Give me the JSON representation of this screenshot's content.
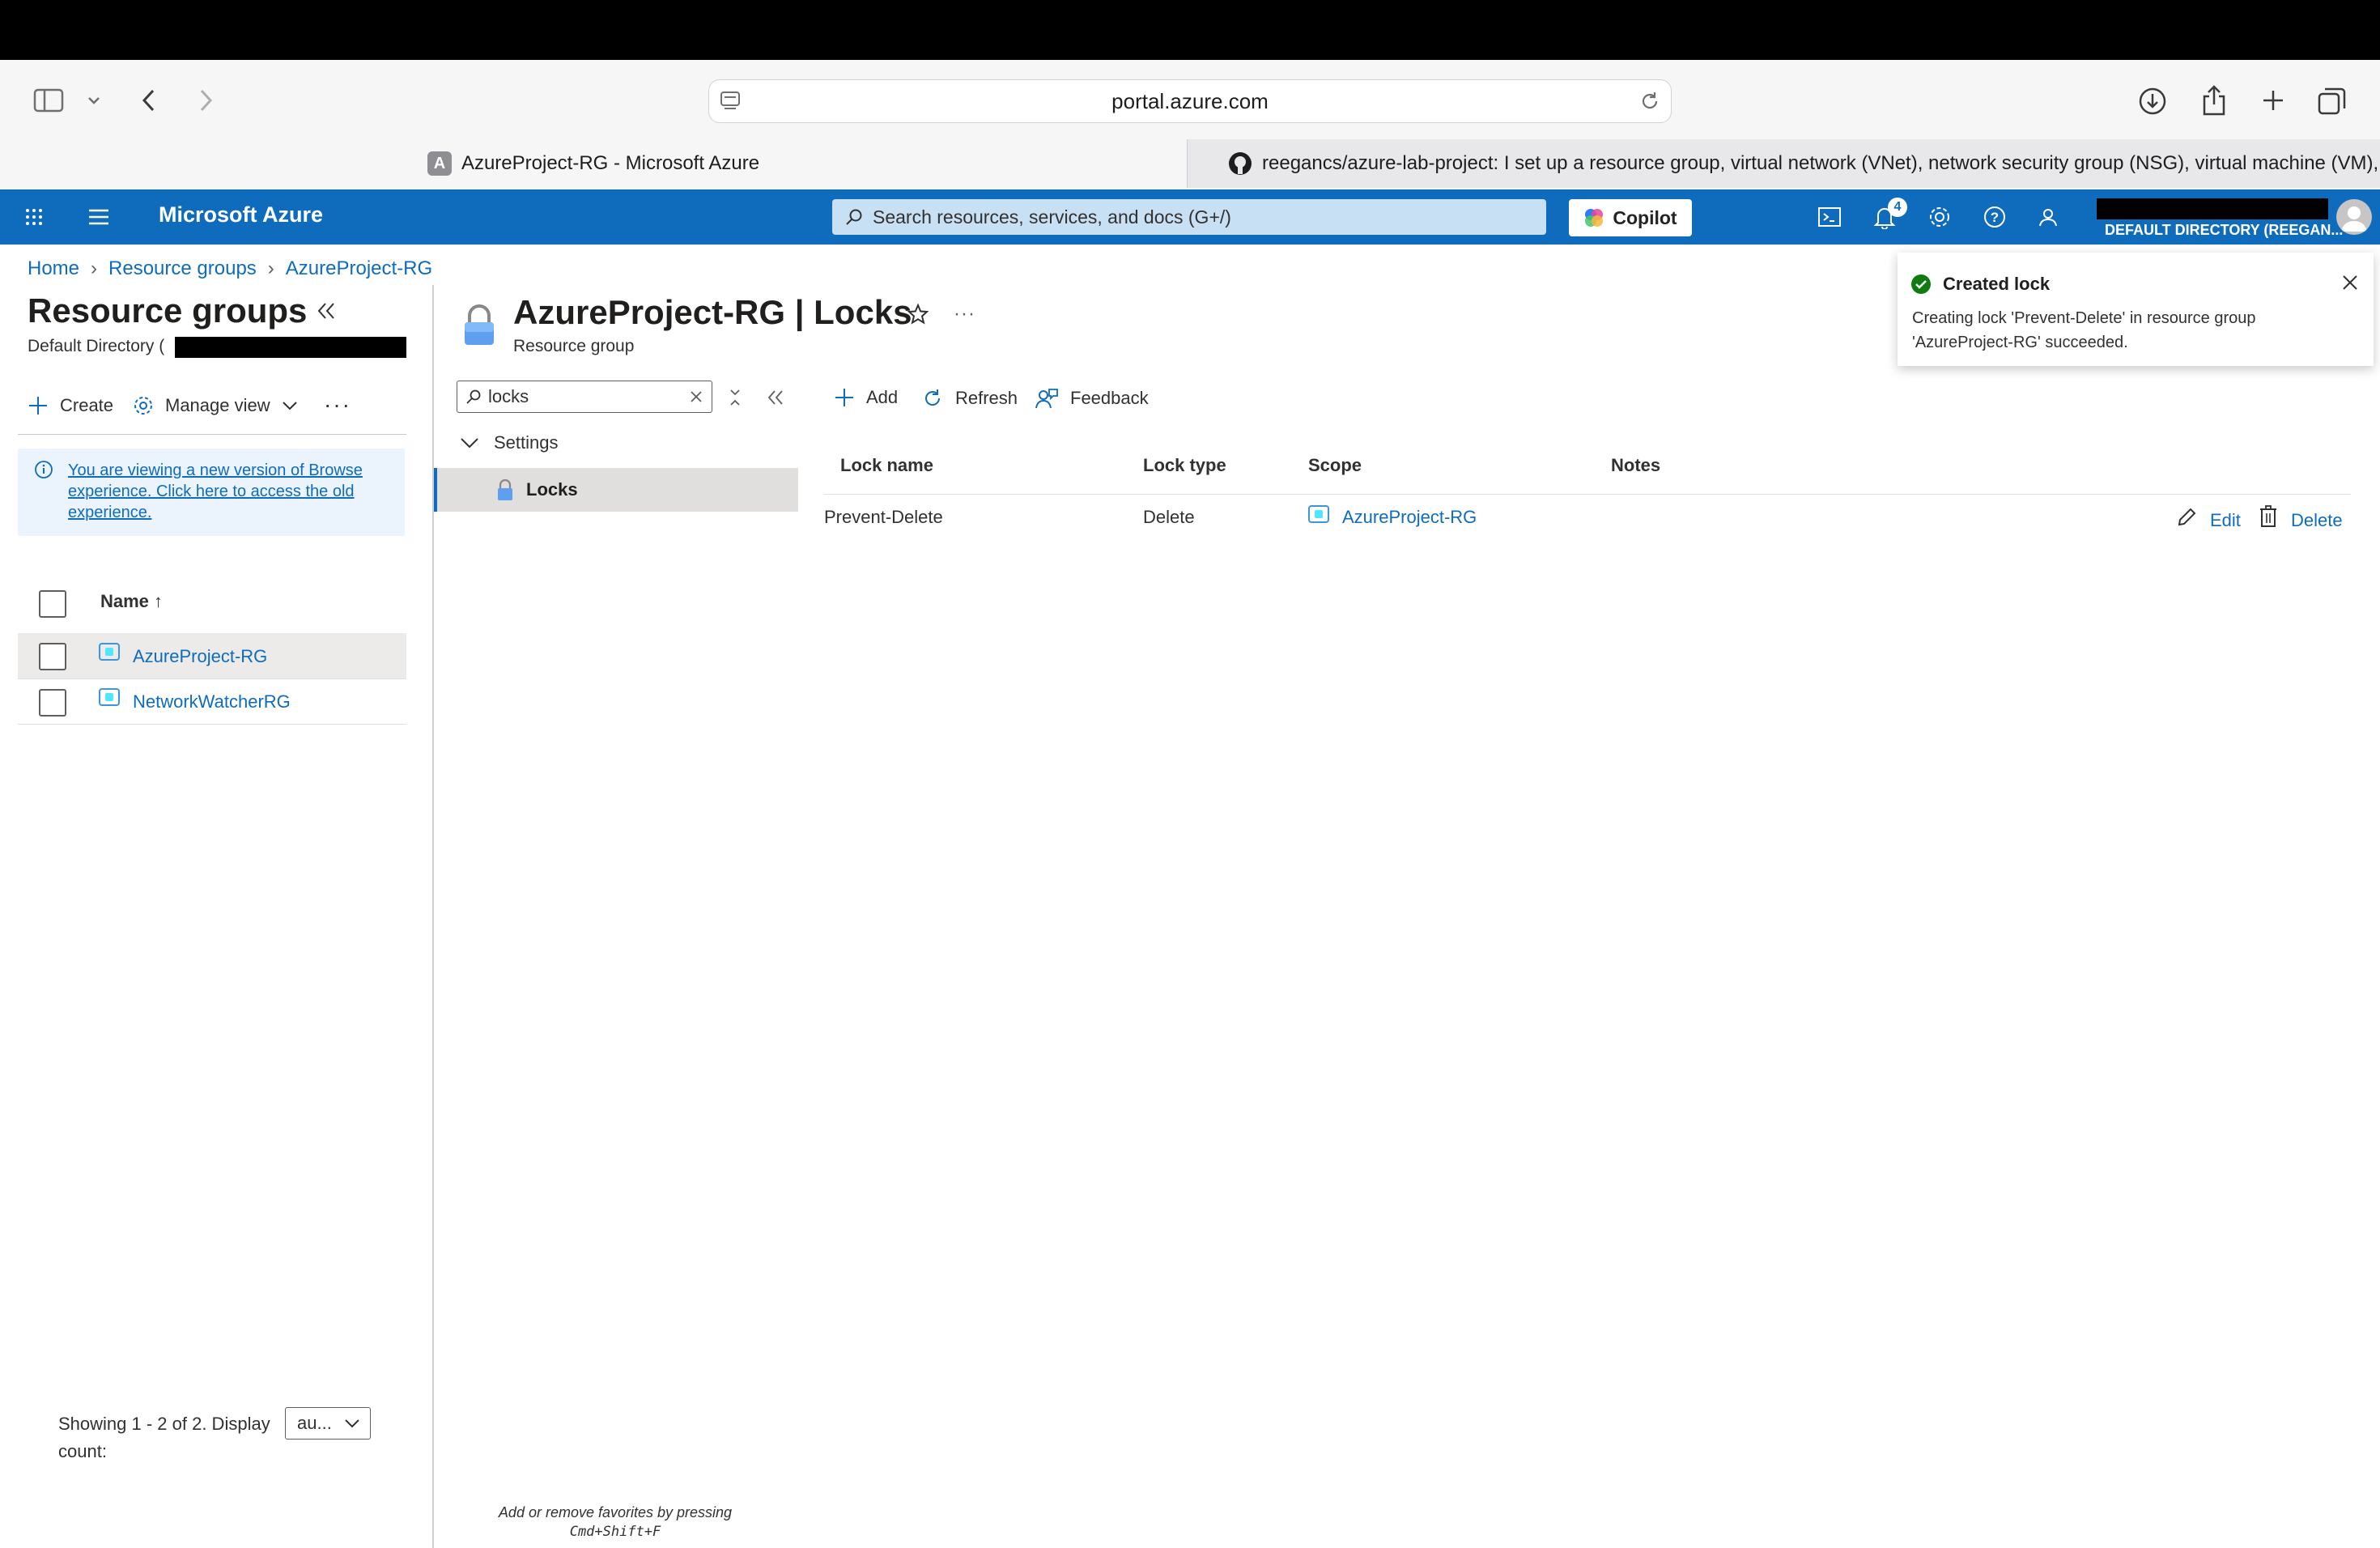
{
  "browser": {
    "url": "portal.azure.com",
    "tabs": [
      {
        "label": "AzureProject-RG - Microsoft Azure",
        "favicon": "A"
      },
      {
        "label": "reegancs/azure-lab-project: I set up a resource group, virtual network (VNet), network security group (NSG), virtual machine (VM),..."
      }
    ]
  },
  "azure_header": {
    "brand": "Microsoft Azure",
    "search_placeholder": "Search resources, services, and docs (G+/)",
    "copilot_label": "Copilot",
    "notification_count": "4",
    "directory": "DEFAULT DIRECTORY (REEGAN..."
  },
  "breadcrumb": [
    "Home",
    "Resource groups",
    "AzureProject-RG"
  ],
  "left_panel": {
    "title": "Resource groups",
    "subtitle": "Default Directory (",
    "create_label": "Create",
    "manage_view_label": "Manage view",
    "info_text": "You are viewing a new version of Browse experience. Click here to access the old experience.",
    "column_name": "Name ↑",
    "rows": [
      "AzureProject-RG",
      "NetworkWatcherRG"
    ],
    "footer_text": "Showing 1 - 2 of 2. Display count:",
    "display_count_value": "au...",
    "favorites_hint_line1": "Add or remove favorites by pressing",
    "favorites_hint_line2": "Cmd+Shift+F"
  },
  "resource": {
    "title": "AzureProject-RG | Locks",
    "type": "Resource group"
  },
  "menu": {
    "search_value": "locks",
    "section": "Settings",
    "selected_item": "Locks"
  },
  "commands": {
    "add": "Add",
    "refresh": "Refresh",
    "feedback": "Feedback"
  },
  "locks_table": {
    "headers": [
      "Lock name",
      "Lock type",
      "Scope",
      "Notes"
    ],
    "rows": [
      {
        "name": "Prevent-Delete",
        "type": "Delete",
        "scope": "AzureProject-RG",
        "notes": "",
        "edit": "Edit",
        "delete": "Delete"
      }
    ]
  },
  "toast": {
    "title": "Created lock",
    "message": "Creating lock 'Prevent-Delete' in resource group 'AzureProject-RG' succeeded."
  }
}
